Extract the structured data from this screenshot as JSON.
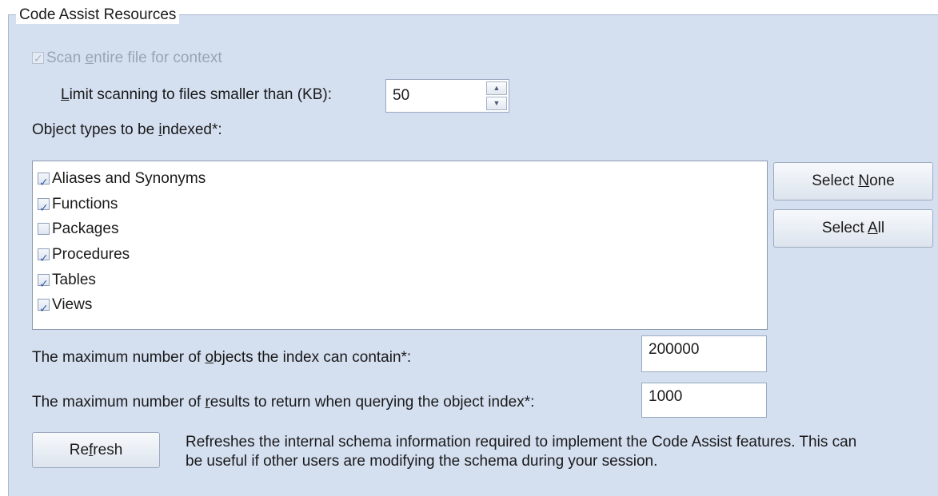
{
  "group": {
    "title": "Code Assist Resources"
  },
  "scan": {
    "label_pre": "Scan ",
    "label_accel": "e",
    "label_post": "ntire file for context",
    "checked": true,
    "enabled": false
  },
  "limit": {
    "label_accel": "L",
    "label_post": "imit scanning to files smaller than (KB):",
    "value": "50"
  },
  "object_types": {
    "label_pre": "Object types to be ",
    "label_accel": "i",
    "label_post": "ndexed*:",
    "items": [
      {
        "label": "Aliases and Synonyms",
        "checked": true
      },
      {
        "label": "Functions",
        "checked": true
      },
      {
        "label": "Packages",
        "checked": false
      },
      {
        "label": "Procedures",
        "checked": true
      },
      {
        "label": "Tables",
        "checked": true
      },
      {
        "label": "Views",
        "checked": true
      }
    ]
  },
  "buttons": {
    "select_none": {
      "pre": "Select ",
      "accel": "N",
      "post": "one"
    },
    "select_all": {
      "pre": "Select ",
      "accel": "A",
      "post": "ll"
    },
    "refresh": {
      "pre": "Re",
      "accel": "f",
      "post": "resh"
    }
  },
  "max_objects": {
    "label_pre": "The maximum number of ",
    "label_accel": "o",
    "label_post": "bjects the index can contain*:",
    "value": "200000"
  },
  "max_results": {
    "label_pre": "The maximum number of ",
    "label_accel": "r",
    "label_post": "esults to return when querying the object index*:",
    "value": "1000"
  },
  "refresh_description": {
    "line1": "Refreshes the internal schema information required to implement the Code Assist features. This can",
    "line2": "be useful if other users are modifying the schema during your session."
  }
}
